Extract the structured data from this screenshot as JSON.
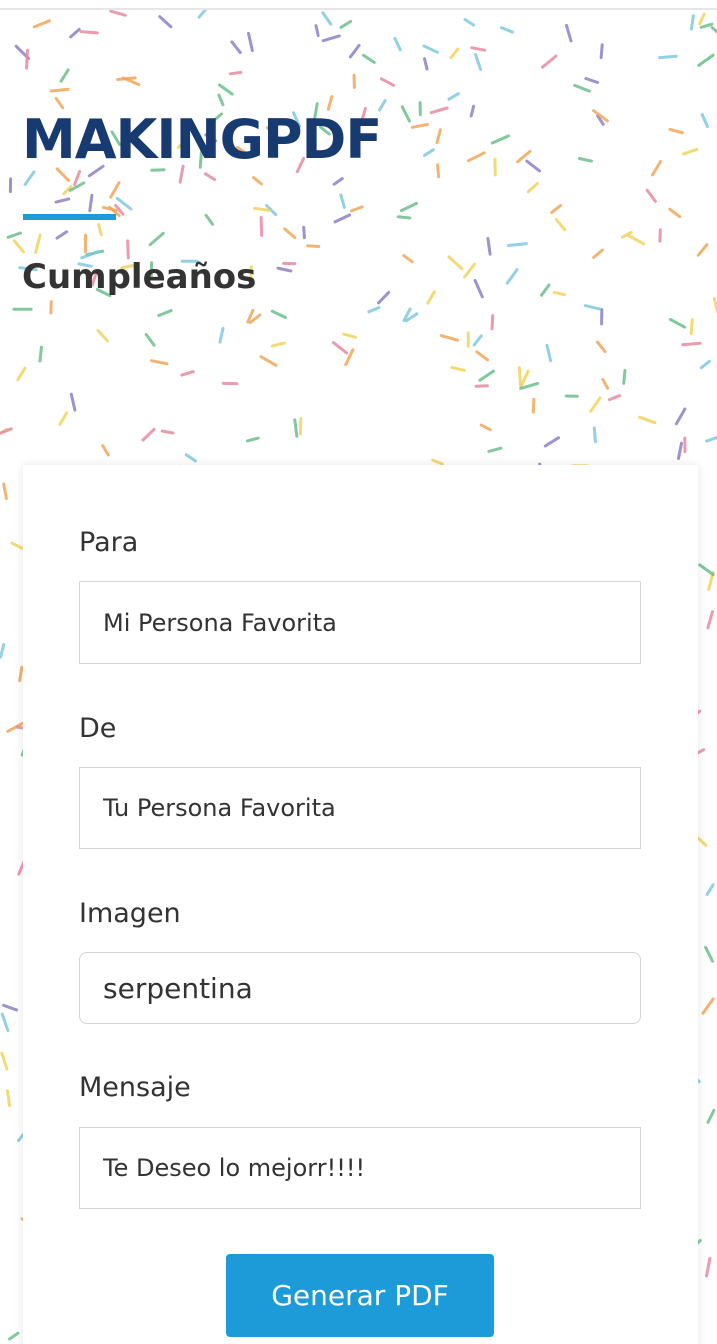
{
  "header": {
    "brand_title": "MAKINGPDF",
    "subtitle": "Cumpleaños"
  },
  "form": {
    "para": {
      "label": "Para",
      "value": "Mi Persona Favorita"
    },
    "de": {
      "label": "De",
      "value": "Tu Persona Favorita"
    },
    "imagen": {
      "label": "Imagen",
      "selected": "serpentina"
    },
    "mensaje": {
      "label": "Mensaje",
      "value": "Te Deseo lo mejorr!!!!"
    },
    "submit_label": "Generar PDF"
  },
  "colors": {
    "brand": "#173a70",
    "accent": "#1d9bd8",
    "sprinkles": [
      "#f2a65a",
      "#7ec8e3",
      "#e98aa2",
      "#6cc08b",
      "#8f7fc6",
      "#f4d35e"
    ]
  }
}
